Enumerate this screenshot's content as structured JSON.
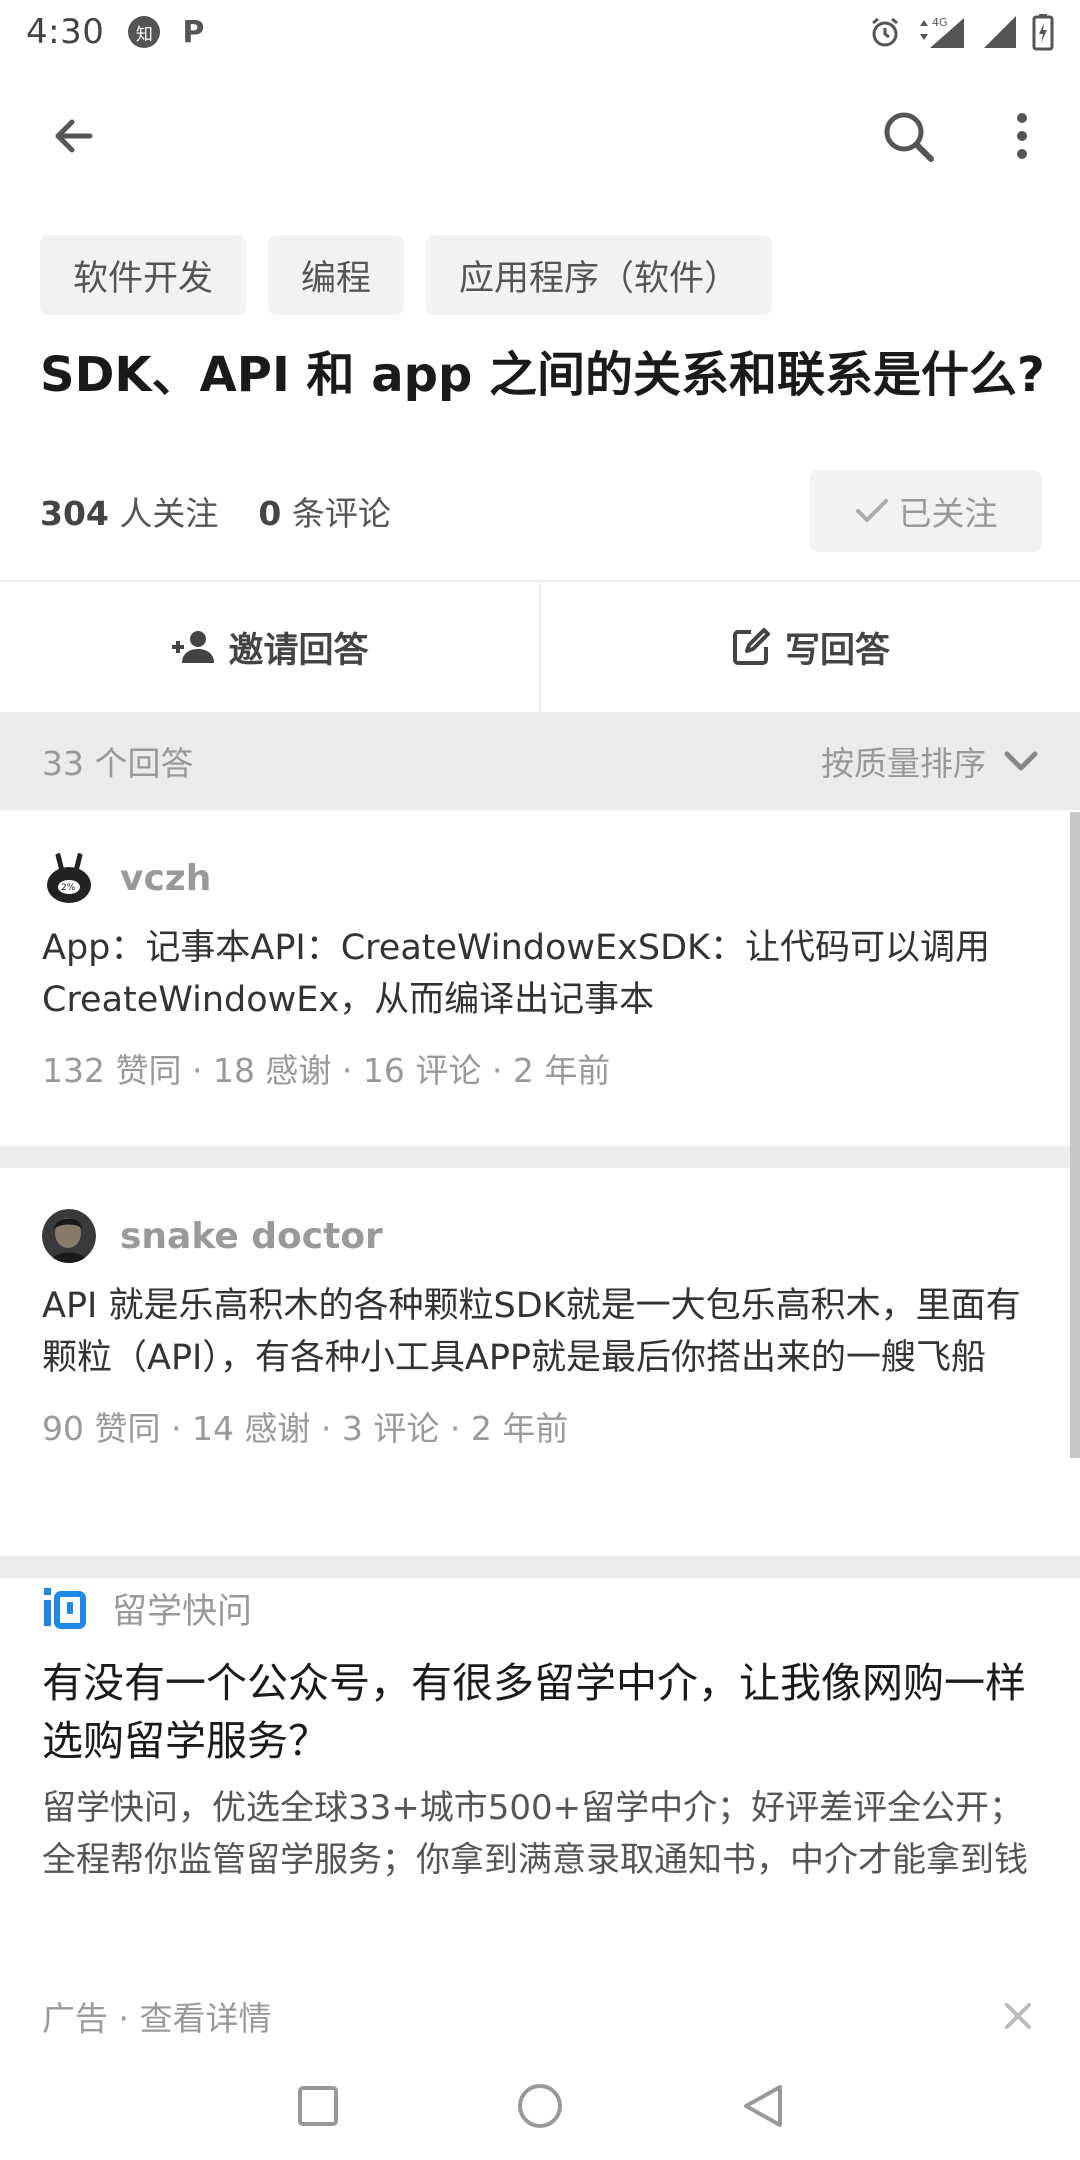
{
  "status_bar": {
    "time": "4:30",
    "notif_zhihu": "知",
    "notif_p": "P"
  },
  "topics": [
    "软件开发",
    "编程",
    "应用程序（软件）"
  ],
  "question": {
    "title": "SDK、API 和 app 之间的关系和联系是什么?",
    "followers_count": "304",
    "followers_label": "人关注",
    "comments_count": "0",
    "comments_label": "条评论",
    "follow_button": "已关注"
  },
  "actions": {
    "invite": "邀请回答",
    "write": "写回答"
  },
  "answers_header": {
    "count": "33 个回答",
    "sort": "按质量排序"
  },
  "answers": [
    {
      "author": "vczh",
      "excerpt": "App：记事本API：CreateWindowExSDK：让代码可以调用CreateWindowEx，从而编译出记事本",
      "stats": "132 赞同 · 18 感谢 · 16 评论 · 2 年前"
    },
    {
      "author": "snake doctor",
      "excerpt": "API 就是乐高积木的各种颗粒SDK就是一大包乐高积木，里面有颗粒（API），有各种小工具APP就是最后你搭出来的一艘飞船",
      "stats": "90 赞同 · 14 感谢 · 3 评论 · 2 年前"
    }
  ],
  "ad": {
    "source": "留学快问",
    "title": "有没有一个公众号，有很多留学中介，让我像网购一样选购留学服务？",
    "description": "留学快问，优选全球33+城市500+留学中介；好评差评全公开；全程帮你监管留学服务；你拿到满意录取通知书，中介才能拿到钱",
    "label": "广告 · 查看详情"
  },
  "colors": {
    "chip_bg": "#f2f2f2",
    "section_bg": "#ebebeb",
    "muted_text": "#999999",
    "ad_logo_blue": "#1e88e5"
  }
}
